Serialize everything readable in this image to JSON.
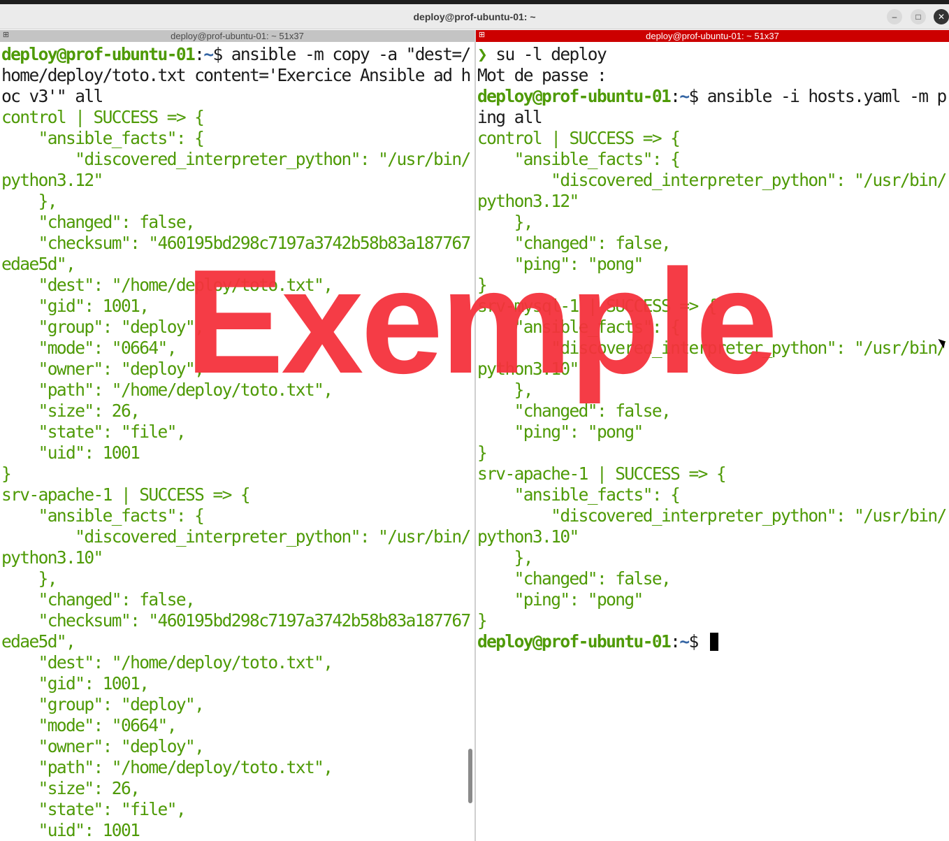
{
  "window": {
    "title": "deploy@prof-ubuntu-01: ~"
  },
  "left_pane": {
    "title": "deploy@prof-ubuntu-01: ~ 51x37",
    "lines": [
      {
        "user": "deploy@prof-ubuntu-01",
        "path": "~",
        "cmd": "$ ansible -m copy -a \"dest=/"
      },
      {
        "text": "home/deploy/toto.txt content='Exercice Ansible ad h"
      },
      {
        "text": "oc v3'\" all"
      },
      {
        "out": "control | SUCCESS => {"
      },
      {
        "out": "    \"ansible_facts\": {"
      },
      {
        "out": "        \"discovered_interpreter_python\": \"/usr/bin/"
      },
      {
        "out": "python3.12\""
      },
      {
        "out": "    },"
      },
      {
        "out": "    \"changed\": false,"
      },
      {
        "out": "    \"checksum\": \"460195bd298c7197a3742b58b83a187767"
      },
      {
        "out": "edae5d\","
      },
      {
        "out": "    \"dest\": \"/home/deploy/toto.txt\","
      },
      {
        "out": "    \"gid\": 1001,"
      },
      {
        "out": "    \"group\": \"deploy\","
      },
      {
        "out": "    \"mode\": \"0664\","
      },
      {
        "out": "    \"owner\": \"deploy\","
      },
      {
        "out": "    \"path\": \"/home/deploy/toto.txt\","
      },
      {
        "out": "    \"size\": 26,"
      },
      {
        "out": "    \"state\": \"file\","
      },
      {
        "out": "    \"uid\": 1001"
      },
      {
        "out": "}"
      },
      {
        "out": "srv-apache-1 | SUCCESS => {"
      },
      {
        "out": "    \"ansible_facts\": {"
      },
      {
        "out": "        \"discovered_interpreter_python\": \"/usr/bin/"
      },
      {
        "out": "python3.10\""
      },
      {
        "out": "    },"
      },
      {
        "out": "    \"changed\": false,"
      },
      {
        "out": "    \"checksum\": \"460195bd298c7197a3742b58b83a187767"
      },
      {
        "out": "edae5d\","
      },
      {
        "out": "    \"dest\": \"/home/deploy/toto.txt\","
      },
      {
        "out": "    \"gid\": 1001,"
      },
      {
        "out": "    \"group\": \"deploy\","
      },
      {
        "out": "    \"mode\": \"0664\","
      },
      {
        "out": "    \"owner\": \"deploy\","
      },
      {
        "out": "    \"path\": \"/home/deploy/toto.txt\","
      },
      {
        "out": "    \"size\": 26,"
      },
      {
        "out": "    \"state\": \"file\","
      },
      {
        "out": "    \"uid\": 1001"
      }
    ]
  },
  "right_pane": {
    "title": "deploy@prof-ubuntu-01: ~ 51x37",
    "lines": [
      {
        "chev": "❯",
        "text": " su -l deploy"
      },
      {
        "text": "Mot de passe :"
      },
      {
        "user": "deploy@prof-ubuntu-01",
        "path": "~",
        "cmd": "$ ansible -i hosts.yaml -m p"
      },
      {
        "text": "ing all"
      },
      {
        "out": "control | SUCCESS => {"
      },
      {
        "out": "    \"ansible_facts\": {"
      },
      {
        "out": "        \"discovered_interpreter_python\": \"/usr/bin/"
      },
      {
        "out": "python3.12\""
      },
      {
        "out": "    },"
      },
      {
        "out": "    \"changed\": false,"
      },
      {
        "out": "    \"ping\": \"pong\""
      },
      {
        "out": "}"
      },
      {
        "out": "srv-mysql-1 | SUCCESS => {"
      },
      {
        "out": "    \"ansible_facts\": {"
      },
      {
        "out": "        \"discovered_interpreter_python\": \"/usr/bin/"
      },
      {
        "out": "python3.10\""
      },
      {
        "out": "    },"
      },
      {
        "out": "    \"changed\": false,"
      },
      {
        "out": "    \"ping\": \"pong\""
      },
      {
        "out": "}"
      },
      {
        "out": "srv-apache-1 | SUCCESS => {"
      },
      {
        "out": "    \"ansible_facts\": {"
      },
      {
        "out": "        \"discovered_interpreter_python\": \"/usr/bin/"
      },
      {
        "out": "python3.10\""
      },
      {
        "out": "    },"
      },
      {
        "out": "    \"changed\": false,"
      },
      {
        "out": "    \"ping\": \"pong\""
      },
      {
        "out": "}"
      },
      {
        "user": "deploy@prof-ubuntu-01",
        "path": "~",
        "cmd": "$ ",
        "cursor": true
      }
    ]
  },
  "watermark": {
    "text": "Exemple",
    "color": "#f4323c"
  },
  "icons": {
    "minimize": "minimize-icon",
    "maximize": "maximize-icon",
    "close": "close-icon"
  }
}
